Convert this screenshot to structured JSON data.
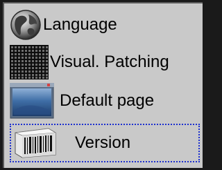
{
  "menu": {
    "items": [
      {
        "label": "Language",
        "icon": "globe-icon"
      },
      {
        "label": "Visual. Patching",
        "icon": "led-grid-icon"
      },
      {
        "label": "Default page",
        "icon": "monitor-page-icon"
      },
      {
        "label": "Version",
        "icon": "barcode-box-icon",
        "selected": true
      }
    ]
  },
  "colors": {
    "panel_bg": "#c9c9c9",
    "focus_border": "#1c2fcf",
    "outer_bg": "#1a1a1a"
  }
}
